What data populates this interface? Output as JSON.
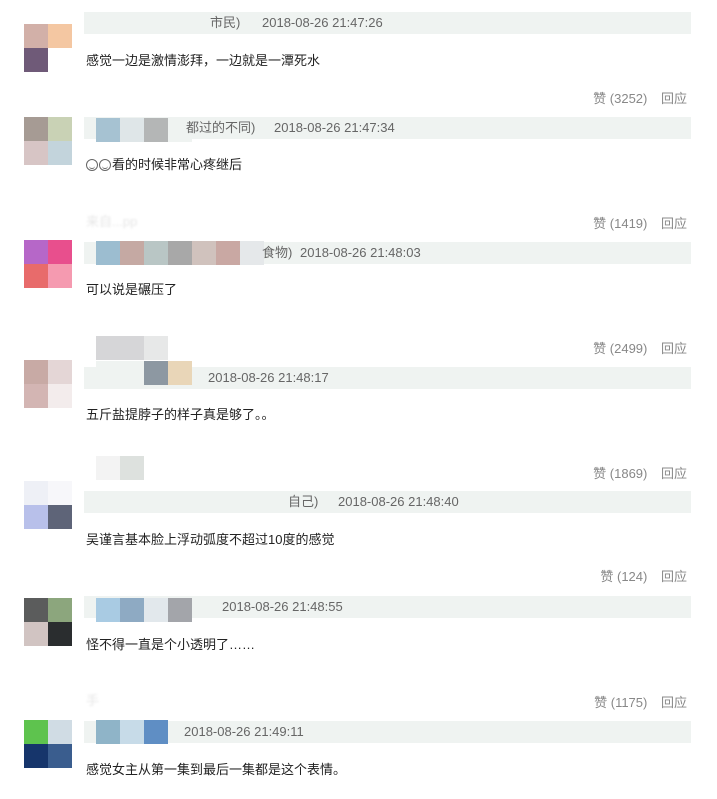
{
  "like_label": "赞",
  "reply_label": "回应",
  "top_bar": {
    "name_tail": "市民)",
    "timestamp": "2018-08-26 21:47:26"
  },
  "comments": [
    {
      "name_tail": "",
      "timestamp": "",
      "text": "感觉一边是激情澎拜，一边就是一潭死水",
      "likes": "(3252)"
    },
    {
      "name_tail": "都过的不同)",
      "timestamp": "2018-08-26 21:47:34",
      "text": "看的时候非常心疼继后",
      "likes": "(1419)"
    },
    {
      "name_tail": "食物)",
      "timestamp": "2018-08-26 21:48:03",
      "text": "可以说是碾压了",
      "likes": "(2499)"
    },
    {
      "name_tail": "",
      "timestamp": "2018-08-26 21:48:17",
      "text": "五斤盐提脖子的样子真是够了。。",
      "likes": "(1869)"
    },
    {
      "name_tail": "自己)",
      "timestamp": "2018-08-26 21:48:40",
      "text": "吴谨言基本脸上浮动弧度不超过10度的感觉",
      "likes": "(124)"
    },
    {
      "name_tail": "",
      "timestamp": "2018-08-26 21:48:55",
      "text": "怪不得一直是个小透明了……",
      "likes": "(1175)"
    },
    {
      "name_tail": "",
      "timestamp": "2018-08-26 21:49:11",
      "text": "感觉女主从第一集到最后一集都是这个表情。",
      "likes": ""
    }
  ],
  "ghost_text": {
    "c2": "来自...pp",
    "c7": "手"
  },
  "colors": {
    "meta_bar": "#eff3f1",
    "meta_text": "#666666",
    "action_text": "#888888",
    "body_text": "#222222"
  }
}
